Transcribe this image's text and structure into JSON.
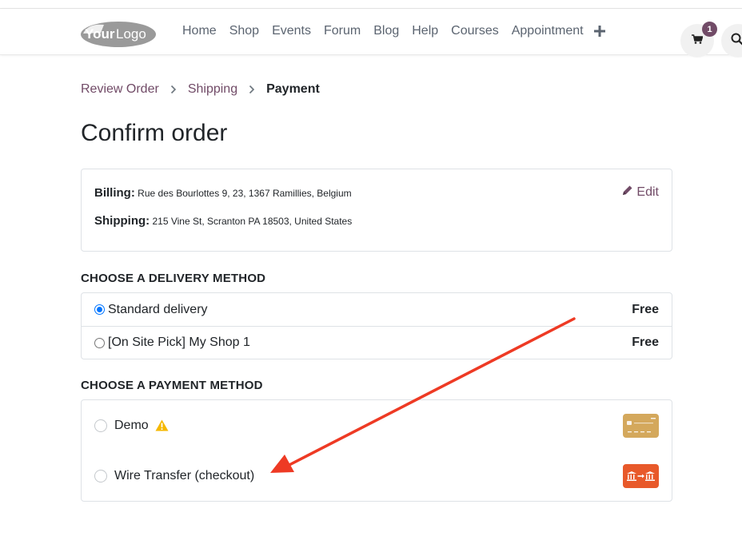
{
  "header": {
    "logo_text_your": "Your",
    "logo_text_logo": "Logo",
    "nav": [
      "Home",
      "Shop",
      "Events",
      "Forum",
      "Blog",
      "Help",
      "Courses",
      "Appointment"
    ],
    "cart_count": "1",
    "icons": {
      "plus": "plus-icon",
      "cart": "cart-icon",
      "search": "search-icon"
    }
  },
  "breadcrumb": {
    "step1": "Review Order",
    "step2": "Shipping",
    "step3": "Payment"
  },
  "page_title": "Confirm order",
  "address": {
    "billing_label": "Billing:",
    "billing_value": "Rue des Bourlottes 9, 23, 1367 Ramillies, Belgium",
    "shipping_label": "Shipping:",
    "shipping_value": "215 Vine St, Scranton PA 18503, United States",
    "edit_label": "Edit"
  },
  "delivery": {
    "title": "CHOOSE A DELIVERY METHOD",
    "options": [
      {
        "label": "Standard delivery",
        "price": "Free",
        "selected": true
      },
      {
        "label": "[On Site Pick] My Shop 1",
        "price": "Free",
        "selected": false
      }
    ]
  },
  "payment": {
    "title": "CHOOSE A PAYMENT METHOD",
    "options": [
      {
        "label": "Demo",
        "warning": true,
        "icon": "credit-card-icon",
        "icon_color": "#d4a85c",
        "selected": false
      },
      {
        "label": "Wire Transfer (checkout)",
        "warning": false,
        "icon": "bank-transfer-icon",
        "icon_color": "#e8592a",
        "selected": false
      }
    ]
  },
  "colors": {
    "brand": "#714b67",
    "radio_checked": "#0075ff",
    "annotation_arrow": "#ee3a24",
    "warning": "#f5b800"
  }
}
